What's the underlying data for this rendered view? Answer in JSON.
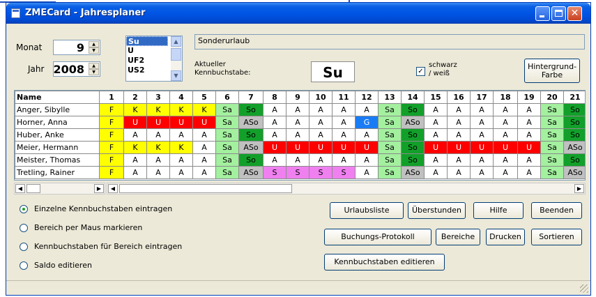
{
  "window": {
    "title": "ZMECard - Jahresplaner",
    "close_glyph": "✕"
  },
  "controls": {
    "monat_label": "Monat",
    "monat_value": "9",
    "jahr_label": "Jahr",
    "jahr_value": "2008",
    "codes_list": [
      "Su",
      "U",
      "UF2",
      "US2"
    ],
    "selected_code_name": "Sonderurlaub",
    "current_label_line1": "Aktueller",
    "current_label_line2": "Kennbuchstabe:",
    "current_code": "Su",
    "bw_checkbox_checked": true,
    "bw_label_line1": "schwarz",
    "bw_label_line2": "/ weiß",
    "bg_button_line1": "Hintergrund-",
    "bg_button_line2": "Farbe"
  },
  "grid": {
    "name_header": "Name",
    "days": [
      "1",
      "2",
      "3",
      "4",
      "5",
      "6",
      "7",
      "8",
      "9",
      "10",
      "11",
      "12",
      "13",
      "14",
      "15",
      "16",
      "17",
      "18",
      "19",
      "20",
      "21"
    ],
    "rows": [
      {
        "name": "Anger, Sibylle",
        "cells": [
          "F",
          "K",
          "K",
          "K",
          "K",
          "Sa",
          "So",
          "A",
          "A",
          "A",
          "A",
          "A",
          "Sa",
          "So",
          "A",
          "A",
          "A",
          "A",
          "A",
          "Sa",
          "So"
        ]
      },
      {
        "name": "Horner, Anna",
        "cells": [
          "F",
          "U",
          "U",
          "U",
          "U",
          "Sa",
          "ASo",
          "A",
          "A",
          "A",
          "A",
          "G",
          "Sa",
          "ASo",
          "A",
          "A",
          "A",
          "A",
          "A",
          "Sa",
          "So"
        ]
      },
      {
        "name": "Huber, Anke",
        "cells": [
          "F",
          "A",
          "A",
          "A",
          "A",
          "Sa",
          "So",
          "A",
          "A",
          "A",
          "A",
          "A",
          "Sa",
          "So",
          "A",
          "A",
          "A",
          "A",
          "A",
          "Sa",
          "So"
        ]
      },
      {
        "name": "Meier, Hermann",
        "cells": [
          "F",
          "K",
          "K",
          "K",
          "A",
          "Sa",
          "ASo",
          "U",
          "U",
          "U",
          "U",
          "U",
          "Sa",
          "So",
          "U",
          "U",
          "U",
          "U",
          "U",
          "Sa",
          "ASo"
        ]
      },
      {
        "name": "Meister, Thomas",
        "cells": [
          "F",
          "A",
          "A",
          "A",
          "A",
          "Sa",
          "So",
          "A",
          "A",
          "A",
          "A",
          "A",
          "Sa",
          "So",
          "A",
          "A",
          "A",
          "A",
          "A",
          "Sa",
          "So"
        ]
      },
      {
        "name": "Tretling, Rainer",
        "cells": [
          "F",
          "A",
          "A",
          "A",
          "A",
          "Sa",
          "ASo",
          "S",
          "S",
          "S",
          "S",
          "A",
          "Sa",
          "ASo",
          "A",
          "A",
          "A",
          "A",
          "A",
          "Sa",
          "ASo"
        ]
      }
    ],
    "code_colors": {
      "F": "#ffff00",
      "K": "#ffff00",
      "U": "#ff0000",
      "G": "#1a7cf5",
      "Sa": "#a3f09f",
      "So": "#12a02a",
      "ASo": "#c0c0c0",
      "S": "#f080f0",
      "A": "#ffffff"
    },
    "code_text_colors": {
      "U": "#ffffff",
      "G": "#ffffff"
    }
  },
  "options": {
    "radio1": "Einzelne Kennbuchstaben eintragen",
    "radio2": "Bereich per Maus markieren",
    "radio3": "Kennbuchstaben für Bereich eintragen",
    "radio4": "Saldo editieren"
  },
  "buttons": {
    "urlaubsliste": "Urlaubsliste",
    "ueberstunden": "Überstunden",
    "hilfe": "Hilfe",
    "beenden": "Beenden",
    "protokoll": "Buchungs-Protokoll",
    "bereiche": "Bereiche",
    "drucken": "Drucken",
    "sortieren": "Sortieren",
    "kennbuchstaben": "Kennbuchstaben editieren"
  }
}
